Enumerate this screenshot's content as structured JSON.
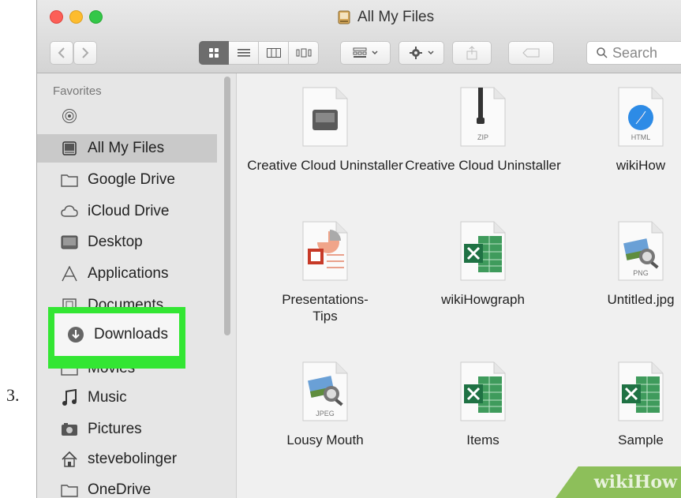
{
  "step_number": "3.",
  "window": {
    "title": "All My Files"
  },
  "toolbar": {
    "back_icon": "chevron-left-icon",
    "forward_icon": "chevron-right-icon",
    "views": [
      "icon-view-icon",
      "list-view-icon",
      "column-view-icon",
      "cover-flow-icon"
    ],
    "search_placeholder": "Search"
  },
  "sidebar": {
    "heading": "Favorites",
    "items": [
      {
        "label": "",
        "icon": "airdrop-icon"
      },
      {
        "label": "All My Files",
        "icon": "all-files-icon",
        "selected": true
      },
      {
        "label": "Google Drive",
        "icon": "folder-icon"
      },
      {
        "label": "iCloud Drive",
        "icon": "cloud-icon"
      },
      {
        "label": "Desktop",
        "icon": "desktop-icon"
      },
      {
        "label": "Applications",
        "icon": "applications-icon"
      },
      {
        "label": "Documents",
        "icon": "documents-icon"
      },
      {
        "label": "Downloads",
        "icon": "downloads-icon",
        "highlighted": true
      },
      {
        "label": "Movies",
        "icon": "movies-icon"
      },
      {
        "label": "Music",
        "icon": "music-icon"
      },
      {
        "label": "Pictures",
        "icon": "pictures-icon"
      },
      {
        "label": "stevebolinger",
        "icon": "home-icon"
      },
      {
        "label": "OneDrive",
        "icon": "folder-icon"
      }
    ],
    "highlight_color": "#33e633"
  },
  "files": [
    {
      "name": "Creative Cloud Uninstaller",
      "icon": "disk-image-icon",
      "tag": ""
    },
    {
      "name": "Creative Cloud Uninstaller",
      "icon": "zip-icon",
      "tag": "ZIP"
    },
    {
      "name": "wikiHow",
      "icon": "html-icon",
      "tag": "HTML"
    },
    {
      "name": "Presentations-Tips",
      "icon": "powerpoint-icon",
      "tag": ""
    },
    {
      "name": "wikiHowgraph",
      "icon": "excel-icon",
      "tag": ""
    },
    {
      "name": "Untitled.jpg",
      "icon": "png-icon",
      "tag": "PNG"
    },
    {
      "name": "Lousy Mouth",
      "icon": "jpeg-icon",
      "tag": "JPEG"
    },
    {
      "name": "Items",
      "icon": "excel-icon",
      "tag": ""
    },
    {
      "name": "Sample",
      "icon": "excel-icon",
      "tag": ""
    }
  ],
  "watermark": {
    "text": "wikiHow"
  }
}
